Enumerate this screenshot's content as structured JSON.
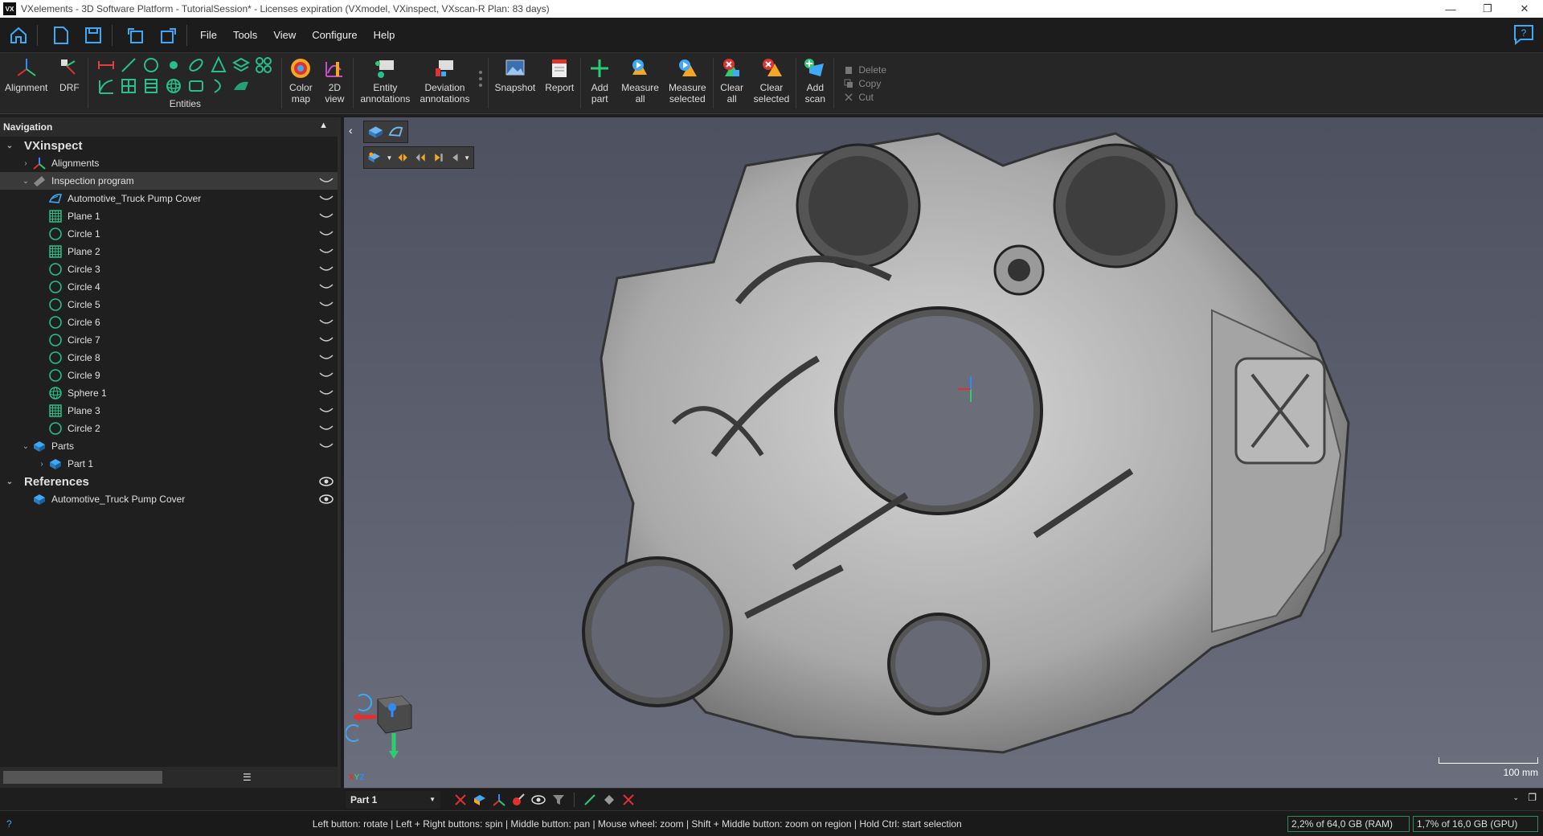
{
  "titlebar": {
    "logo": "VX",
    "title": "VXelements - 3D Software Platform - TutorialSession* - Licenses expiration (VXmodel, VXinspect, VXscan-R Plan: 83 days)",
    "minimize": "—",
    "restore": "❐",
    "close": "✕"
  },
  "menus": [
    "File",
    "Tools",
    "View",
    "Configure",
    "Help"
  ],
  "ribbon": {
    "alignment": "Alignment",
    "drf": "DRF",
    "entities": "Entities",
    "color_map": "Color\nmap",
    "view_2d": "2D\nview",
    "entity_annotations": "Entity\nannotations",
    "deviation_annotations": "Deviation\nannotations",
    "snapshot": "Snapshot",
    "report": "Report",
    "add_part": "Add\npart",
    "measure_all": "Measure\nall",
    "measure_selected": "Measure\nselected",
    "clear_all": "Clear\nall",
    "clear_selected": "Clear\nselected",
    "add_scan": "Add\nscan",
    "delete": "Delete",
    "copy": "Copy",
    "cut": "Cut"
  },
  "navigation": {
    "title": "Navigation",
    "vxinspect": "VXinspect",
    "alignments": "Alignments",
    "inspection_program": "Inspection program",
    "items": [
      {
        "label": "Automotive_Truck Pump Cover",
        "icon": "mesh-icon"
      },
      {
        "label": "Plane 1",
        "icon": "plane-icon"
      },
      {
        "label": "Circle 1",
        "icon": "circle-icon"
      },
      {
        "label": "Plane 2",
        "icon": "plane-icon"
      },
      {
        "label": "Circle 3",
        "icon": "circle-icon"
      },
      {
        "label": "Circle 4",
        "icon": "circle-icon"
      },
      {
        "label": "Circle 5",
        "icon": "circle-icon"
      },
      {
        "label": "Circle 6",
        "icon": "circle-icon"
      },
      {
        "label": "Circle 7",
        "icon": "circle-icon"
      },
      {
        "label": "Circle 8",
        "icon": "circle-icon"
      },
      {
        "label": "Circle 9",
        "icon": "circle-icon"
      },
      {
        "label": "Sphere 1",
        "icon": "sphere-icon"
      },
      {
        "label": "Plane 3",
        "icon": "plane-icon"
      },
      {
        "label": "Circle 2",
        "icon": "circle-icon"
      }
    ],
    "parts": "Parts",
    "part1": "Part 1",
    "references": "References",
    "ref_item": "Automotive_Truck Pump Cover"
  },
  "viewport": {
    "scale_label": "100 mm",
    "axes_label_x": "X",
    "axes_label_y": "Y",
    "axes_label_z": "Z"
  },
  "bottombar": {
    "part_select": "Part 1"
  },
  "status": {
    "hint": "Left button: rotate  |  Left + Right buttons: spin  |  Middle button: pan  |  Mouse wheel: zoom  |  Shift + Middle button: zoom on region  |  Hold Ctrl: start selection",
    "ram": "2,2% of 64,0 GB (RAM)",
    "gpu": "1,7% of 16,0 GB (GPU)",
    "help_glyph": "?"
  },
  "colors": {
    "accent_green": "#2ecc71",
    "accent_blue": "#3fa9f5",
    "entity_green": "#27c08a"
  }
}
